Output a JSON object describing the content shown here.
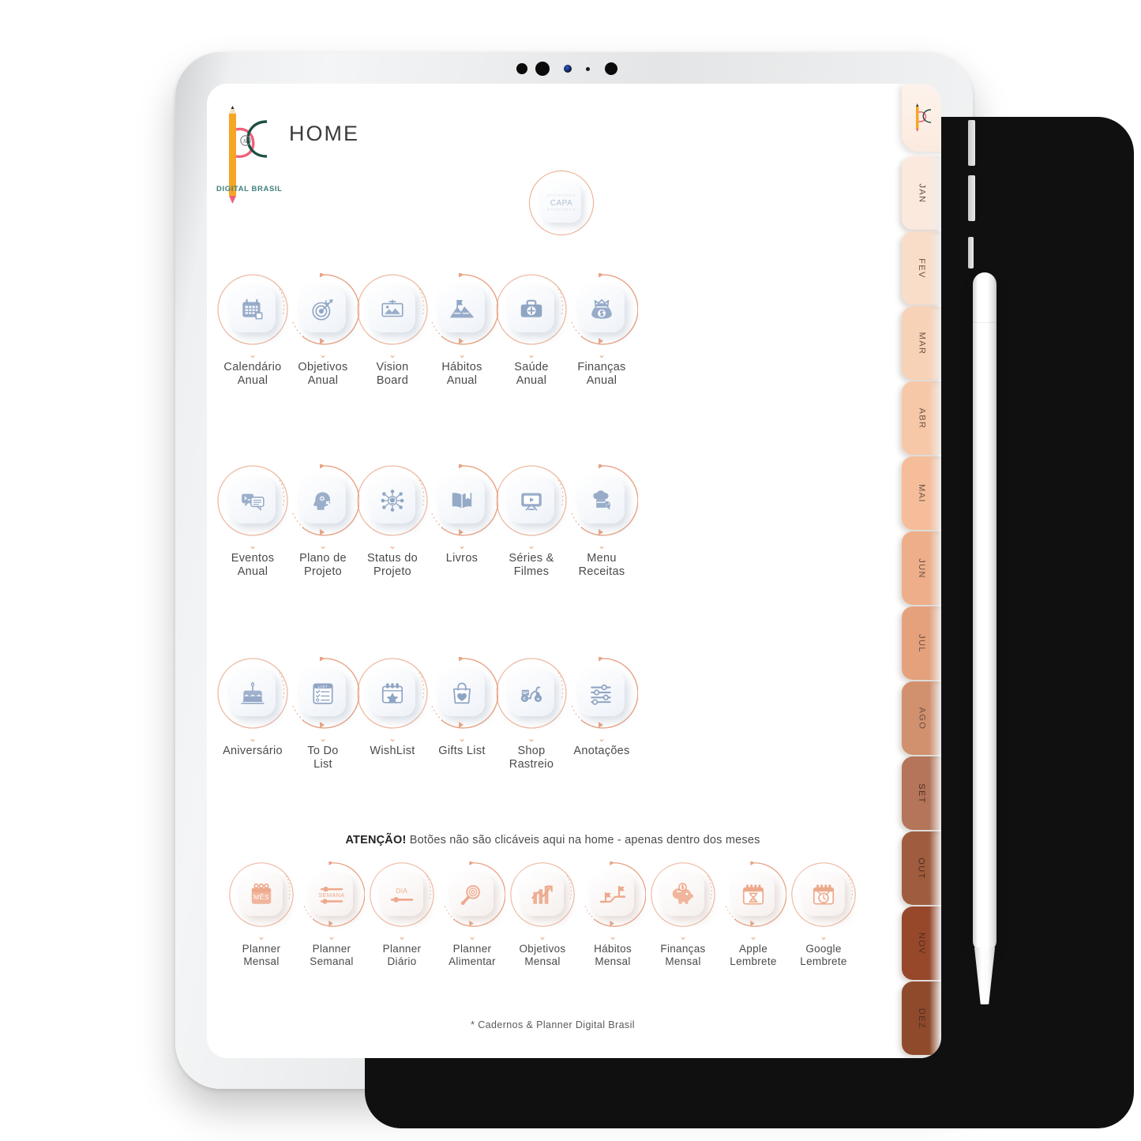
{
  "app": {
    "title": "HOME",
    "brand_caption": "DIGITAL BRASIL",
    "footer": "* Cadernos & Planner Digital Brasil",
    "notice_bold": "ATENÇÃO!",
    "notice_rest": " Botões não são clicáveis aqui na home - apenas dentro dos meses"
  },
  "cover": {
    "label": "CAPA",
    "dots": "○○○○○○○○"
  },
  "colors": {
    "accent_orange": "#e9a98a",
    "icon_blue": "#8fa5c4",
    "icon_warm": "#eda98c",
    "text": "#4a4a4a",
    "brand_teal": "#3f7f7c",
    "brand_pink": "#f0607a",
    "brand_green": "#1f4f45",
    "brand_yellow": "#f5a623"
  },
  "rows": [
    {
      "name": "annual-section",
      "items": [
        {
          "label": "Calendário\nAnual",
          "icon": "calendar-icon"
        },
        {
          "label": "Objetivos\nAnual",
          "icon": "target-icon"
        },
        {
          "label": "Vision\nBoard",
          "icon": "picture-frame-icon"
        },
        {
          "label": "Hábitos\nAnual",
          "icon": "mountain-flag-icon"
        },
        {
          "label": "Saúde\nAnual",
          "icon": "first-aid-kit-icon"
        },
        {
          "label": "Finanças\nAnual",
          "icon": "money-bag-icon"
        }
      ]
    },
    {
      "name": "projects-section",
      "items": [
        {
          "label": "Eventos\nAnual",
          "icon": "chat-bubbles-icon"
        },
        {
          "label": "Plano de\nProjeto",
          "icon": "head-gears-icon"
        },
        {
          "label": "Status do\nProjeto",
          "icon": "network-idea-icon"
        },
        {
          "label": "Livros",
          "icon": "open-book-icon"
        },
        {
          "label": "Séries &\nFilmes",
          "icon": "tv-play-icon"
        },
        {
          "label": "Menu\nReceitas",
          "icon": "chef-hat-whisk-icon"
        }
      ]
    },
    {
      "name": "lists-section",
      "items": [
        {
          "label": "Aniversário",
          "icon": "birthday-cake-icon"
        },
        {
          "label": "To Do\nList",
          "icon": "checklist-icon"
        },
        {
          "label": "WishList",
          "icon": "calendar-star-icon"
        },
        {
          "label": "Gifts List",
          "icon": "gift-bag-heart-icon"
        },
        {
          "label": "Shop\nRastreio",
          "icon": "delivery-scooter-icon"
        },
        {
          "label": "Anotações",
          "icon": "sliders-icon"
        }
      ]
    }
  ],
  "bottom_row": {
    "name": "monthly-section",
    "items": [
      {
        "label": "Planner\nMensal",
        "icon": "calendar-month-icon",
        "glyph_text": "MÊS"
      },
      {
        "label": "Planner\nSemanal",
        "icon": "week-sliders-icon",
        "glyph_text": "SEMANA"
      },
      {
        "label": "Planner\nDiário",
        "icon": "day-slider-icon",
        "glyph_text": "DIA"
      },
      {
        "label": "Planner\nAlimentar",
        "icon": "frying-pan-icon",
        "glyph_text": ""
      },
      {
        "label": "Objetivos\nMensal",
        "icon": "growth-chart-icon",
        "glyph_text": ""
      },
      {
        "label": "Hábitos\nMensal",
        "icon": "flag-path-icon",
        "glyph_text": ""
      },
      {
        "label": "Finanças\nMensal",
        "icon": "piggy-bank-icon",
        "glyph_text": ""
      },
      {
        "label": "Apple\nLembrete",
        "icon": "calendar-hourglass-icon",
        "glyph_text": ""
      },
      {
        "label": "Google\nLembrete",
        "icon": "calendar-clock-icon",
        "glyph_text": ""
      }
    ]
  },
  "month_tabs": [
    {
      "label": "JAN",
      "color": "#fbe9dd"
    },
    {
      "label": "FEV",
      "color": "#f9ddc8"
    },
    {
      "label": "MAR",
      "color": "#f8d2b7"
    },
    {
      "label": "ABR",
      "color": "#f7c8a8"
    },
    {
      "label": "MAI",
      "color": "#f5bd9a"
    },
    {
      "label": "JUN",
      "color": "#eeae8a"
    },
    {
      "label": "JUL",
      "color": "#e5a17c"
    },
    {
      "label": "AGO",
      "color": "#d1906e"
    },
    {
      "label": "SET",
      "color": "#b4755a"
    },
    {
      "label": "OUT",
      "color": "#a05c3e"
    },
    {
      "label": "NOV",
      "color": "#97482a"
    },
    {
      "label": "DEZ",
      "color": "#8f4a2c"
    }
  ]
}
